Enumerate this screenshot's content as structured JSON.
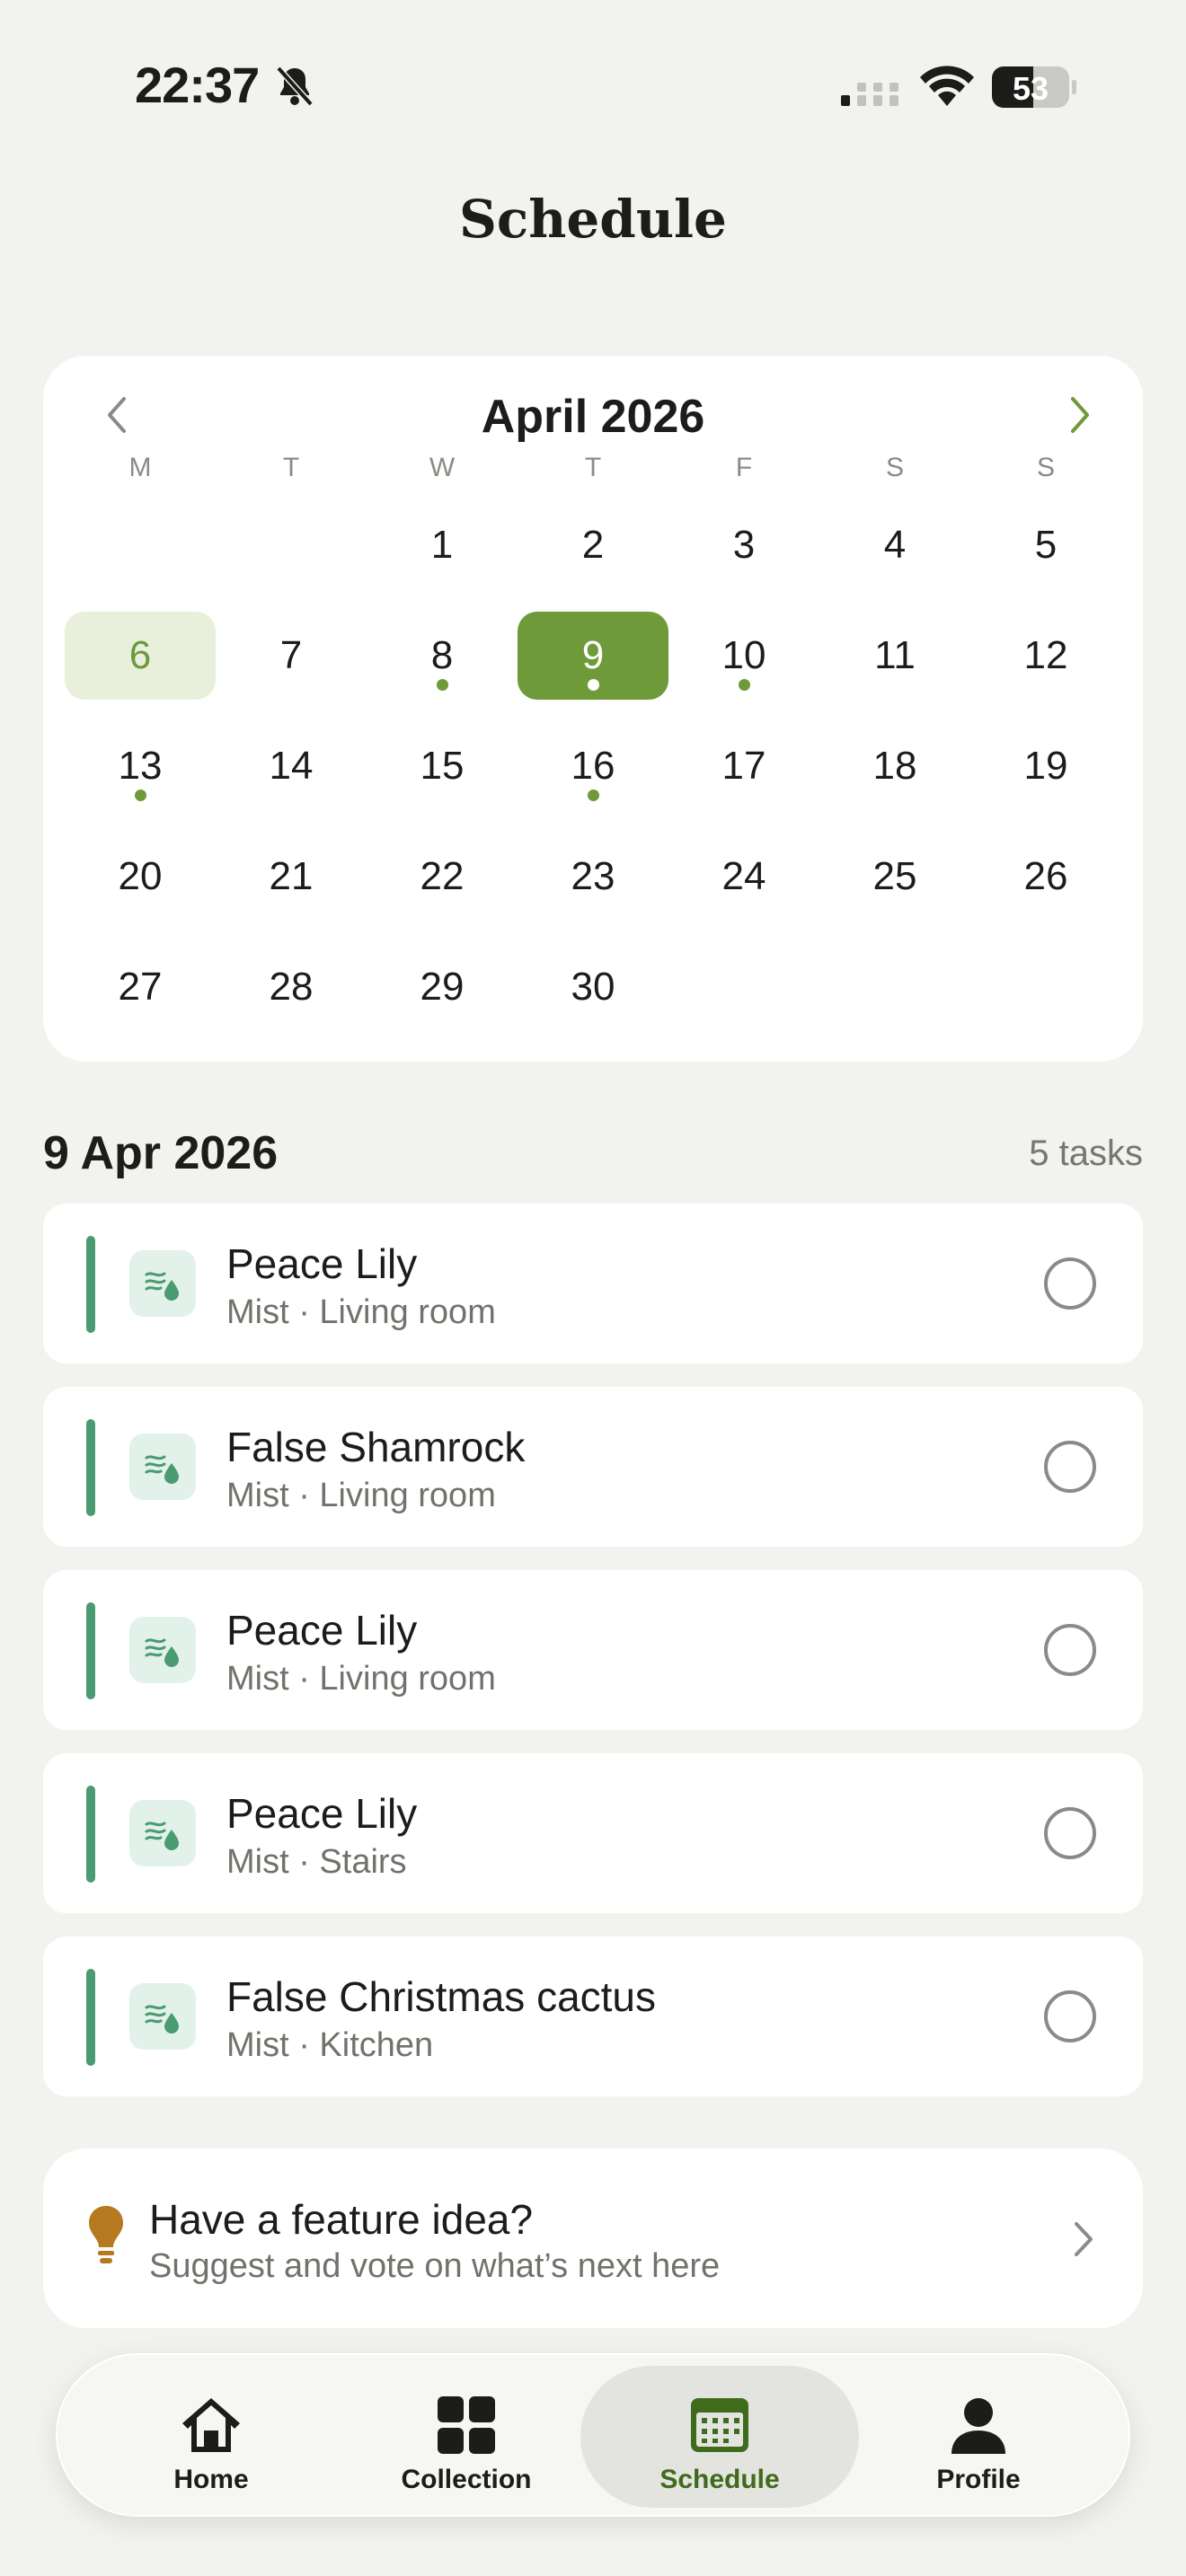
{
  "status_bar": {
    "time": "22:37",
    "battery": "53"
  },
  "header": {
    "title": "Schedule"
  },
  "calendar": {
    "month": "April 2026",
    "weekdays": [
      "M",
      "T",
      "W",
      "T",
      "F",
      "S",
      "S"
    ],
    "days": [
      {
        "label": ""
      },
      {
        "label": ""
      },
      {
        "label": "1"
      },
      {
        "label": "2"
      },
      {
        "label": "3"
      },
      {
        "label": "4"
      },
      {
        "label": "5"
      },
      {
        "label": "6",
        "today": true
      },
      {
        "label": "7"
      },
      {
        "label": "8",
        "dot": true
      },
      {
        "label": "9",
        "selected": true,
        "dot": true
      },
      {
        "label": "10",
        "dot": true
      },
      {
        "label": "11"
      },
      {
        "label": "12"
      },
      {
        "label": "13",
        "dot": true
      },
      {
        "label": "14"
      },
      {
        "label": "15"
      },
      {
        "label": "16",
        "dot": true
      },
      {
        "label": "17"
      },
      {
        "label": "18"
      },
      {
        "label": "19"
      },
      {
        "label": "20"
      },
      {
        "label": "21"
      },
      {
        "label": "22"
      },
      {
        "label": "23"
      },
      {
        "label": "24"
      },
      {
        "label": "25"
      },
      {
        "label": "26"
      },
      {
        "label": "27"
      },
      {
        "label": "28"
      },
      {
        "label": "29"
      },
      {
        "label": "30"
      }
    ],
    "accent": "#6e9a3a"
  },
  "tasks": {
    "date_label": "9 Apr 2026",
    "count_label": "5 tasks",
    "items": [
      {
        "name": "Peace Lily",
        "detail": "Mist · Living room",
        "icon": "mist-icon"
      },
      {
        "name": "False Shamrock",
        "detail": "Mist · Living room",
        "icon": "mist-icon"
      },
      {
        "name": "Peace Lily",
        "detail": "Mist · Living room",
        "icon": "mist-icon"
      },
      {
        "name": "Peace Lily",
        "detail": "Mist · Stairs",
        "icon": "mist-icon"
      },
      {
        "name": "False Christmas cactus",
        "detail": "Mist · Kitchen",
        "icon": "mist-icon"
      }
    ]
  },
  "feature_idea": {
    "title": "Have a feature idea?",
    "subtitle": "Suggest and vote on what’s next here"
  },
  "tab_bar": {
    "tabs": [
      {
        "label": "Home",
        "icon": "home-icon"
      },
      {
        "label": "Collection",
        "icon": "grid-icon"
      },
      {
        "label": "Schedule",
        "icon": "calendar-icon",
        "active": true
      },
      {
        "label": "Profile",
        "icon": "person-icon"
      }
    ]
  }
}
